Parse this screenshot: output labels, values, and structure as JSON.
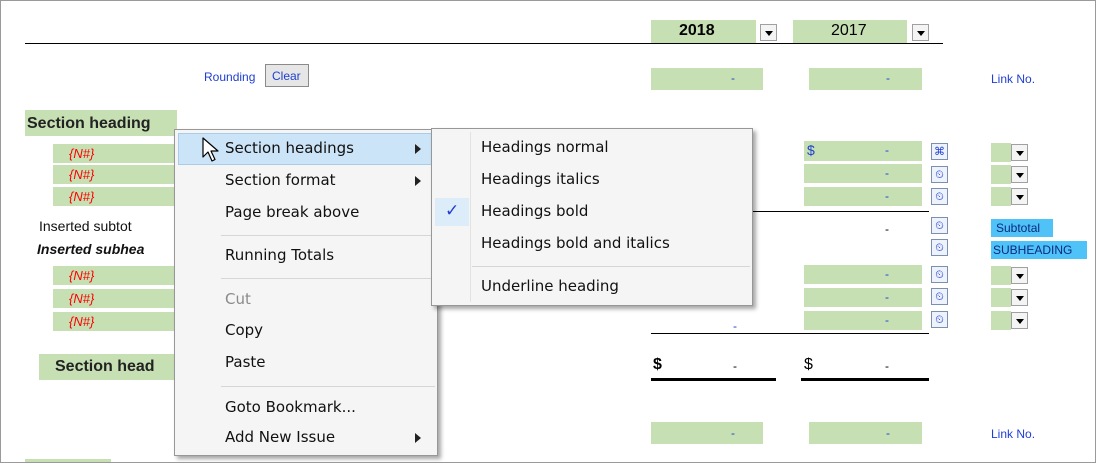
{
  "header": {
    "years": [
      "2018",
      "2017"
    ]
  },
  "toolbar": {
    "rounding_label": "Rounding",
    "clear_label": "Clear"
  },
  "link_no_label": "Link No.",
  "dash": "-",
  "dollar": "$",
  "section_heading": "Section heading",
  "section_heading_total": "Section head",
  "tag": "{N#}",
  "inserted_subtotal": "Inserted subtot",
  "inserted_subheading": "Inserted subhea",
  "badges": {
    "subtotal": "Subtotal",
    "subheading": "SUBHEADING"
  },
  "context_menu": {
    "items": [
      {
        "label": "Section headings",
        "submenu": true,
        "highlighted": true
      },
      {
        "label": "Section format",
        "submenu": true
      },
      {
        "label": "Page break above"
      },
      {
        "label": "Running Totals"
      },
      {
        "label": "Cut",
        "disabled": true
      },
      {
        "label": "Copy"
      },
      {
        "label": "Paste"
      },
      {
        "label": "Goto Bookmark..."
      },
      {
        "label": "Add New Issue",
        "submenu": true
      }
    ]
  },
  "submenu": {
    "items": [
      {
        "label": "Headings normal"
      },
      {
        "label": "Headings italics"
      },
      {
        "label": "Headings bold",
        "checked": true
      },
      {
        "label": "Headings bold and italics"
      },
      {
        "label": "Underline heading"
      }
    ],
    "check_glyph": "✓"
  },
  "colors": {
    "cell_green": "#c6e0b4",
    "link_blue": "#1f3fd1",
    "tag_red": "#ff0000",
    "badge_blue": "#4fc3f7",
    "menu_highlight": "#cce4f7"
  }
}
